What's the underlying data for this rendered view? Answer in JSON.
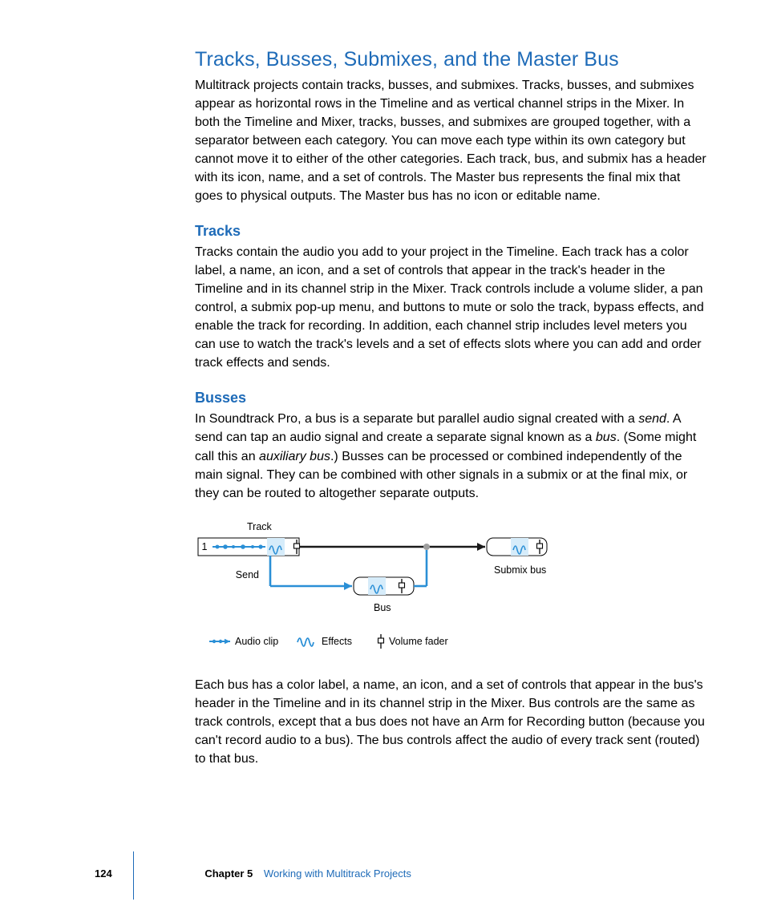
{
  "heading_main": "Tracks, Busses, Submixes, and the Master Bus",
  "para_intro": "Multitrack projects contain tracks, busses, and submixes. Tracks, busses, and submixes appear as horizontal rows in the Timeline and as vertical channel strips in the Mixer. In both the Timeline and Mixer, tracks, busses, and submixes are grouped together, with a separator between each category. You can move each type within its own category but cannot move it to either of the other categories. Each track, bus, and submix has a header with its icon, name, and a set of controls. The Master bus represents the final mix that goes to physical outputs. The Master bus has no icon or editable name.",
  "heading_tracks": "Tracks",
  "para_tracks": "Tracks contain the audio you add to your project in the Timeline. Each track has a color label, a name, an icon, and a set of controls that appear in the track's header in the Timeline and in its channel strip in the Mixer. Track controls include a volume slider, a pan control, a submix pop-up menu, and buttons to mute or solo the track, bypass effects, and enable the track for recording. In addition, each channel strip includes level meters you can use to watch the track's levels and a set of effects slots where you can add and order track effects and sends.",
  "heading_busses": "Busses",
  "para_busses_1_a": "In Soundtrack Pro, a bus is a separate but parallel audio signal created with a ",
  "para_busses_1_b": "send",
  "para_busses_1_c": ". A send can tap an audio signal and create a separate signal known as a ",
  "para_busses_1_d": "bus",
  "para_busses_1_e": ". (Some might call this an ",
  "para_busses_1_f": "auxiliary bus",
  "para_busses_1_g": ".) Busses can be processed or combined independently of the main signal. They can be combined with other signals in a submix or at the final mix, or they can be routed to altogether separate outputs.",
  "para_busses_2": "Each bus has a color label, a name, an icon, and a set of controls that appear in the bus's header in the Timeline and in its channel strip in the Mixer. Bus controls are the same as track controls, except that a bus does not have an Arm for Recording button (because you can't record audio to a bus). The bus controls affect the audio of every track sent (routed) to that bus.",
  "diagram": {
    "track_number": "1",
    "label_track": "Track",
    "label_send": "Send",
    "label_bus": "Bus",
    "label_submix": "Submix bus",
    "legend_audio": "Audio clip",
    "legend_effects": "Effects",
    "legend_fader": "Volume fader"
  },
  "footer": {
    "page": "124",
    "chapter": "Chapter 5",
    "chapter_title": "Working with Multitrack Projects"
  }
}
